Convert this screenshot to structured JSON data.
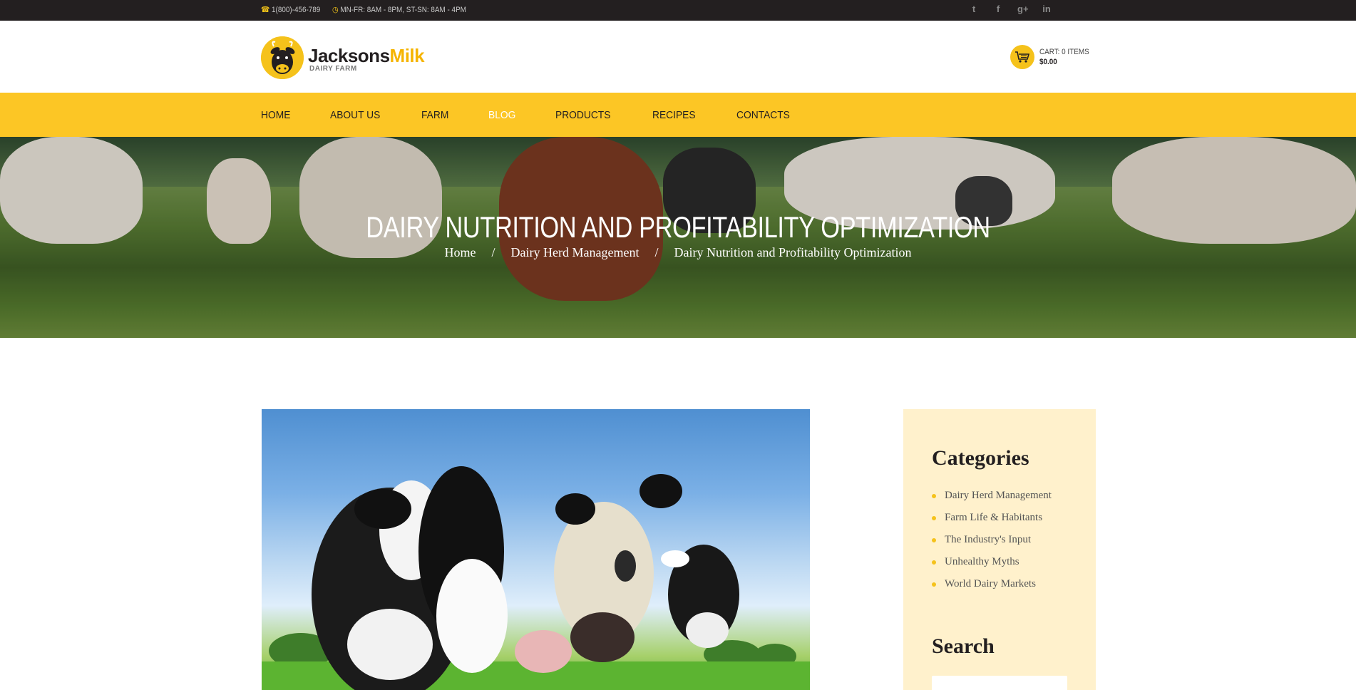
{
  "topbar": {
    "phone": "1(800)-456-789",
    "hours": "MN-FR: 8AM - 8PM, ST-SN: 8AM - 4PM",
    "social": [
      {
        "icon": "twitter-icon",
        "glyph": "t"
      },
      {
        "icon": "facebook-icon",
        "glyph": "f"
      },
      {
        "icon": "google-plus-icon",
        "glyph": "g+"
      },
      {
        "icon": "linkedin-icon",
        "glyph": "in"
      }
    ]
  },
  "header": {
    "logo_name_1": "Jacksons",
    "logo_name_2": "Milk",
    "logo_sub": "DAIRY FARM",
    "cart_label": "CART: 0 ITEMS",
    "cart_amount": "$0.00"
  },
  "nav": {
    "items": [
      "HOME",
      "ABOUT US",
      "FARM",
      "BLOG",
      "PRODUCTS",
      "RECIPES",
      "CONTACTS"
    ],
    "active": "BLOG"
  },
  "hero": {
    "title": "DAIRY NUTRITION AND PROFITABILITY OPTIMIZATION",
    "breadcrumb": [
      "Home",
      "Dairy Herd Management",
      "Dairy Nutrition and Profitability Optimization"
    ],
    "separator": "/"
  },
  "sidebar": {
    "categories_title": "Categories",
    "categories": [
      "Dairy Herd Management",
      "Farm Life & Habitants",
      "The Industry's Input",
      "Unhealthy Myths",
      "World Dairy Markets"
    ],
    "search_title": "Search"
  },
  "colors": {
    "accent": "#fcc625",
    "dark": "#231f20",
    "sidebar_bg": "#fff1cc"
  }
}
